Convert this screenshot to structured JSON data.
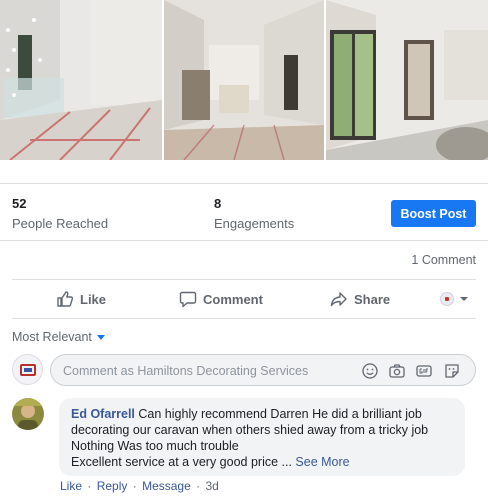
{
  "photos": [
    {
      "name": "room-photo-1"
    },
    {
      "name": "room-photo-2"
    },
    {
      "name": "room-photo-3"
    }
  ],
  "stats": {
    "reached_count": "52",
    "reached_label": "People Reached",
    "engagements_count": "8",
    "engagements_label": "Engagements",
    "boost_label": "Boost Post"
  },
  "comment_count": "1 Comment",
  "actions": {
    "like": "Like",
    "comment": "Comment",
    "share": "Share"
  },
  "sort_label": "Most Relevant",
  "composer": {
    "placeholder": "Comment as Hamiltons Decorating Services",
    "icons": [
      "emoji-icon",
      "camera-icon",
      "gif-icon",
      "sticker-icon"
    ]
  },
  "comment": {
    "author": "Ed Ofarrell",
    "text_1": "Can highly recommend Darren He did a brilliant job",
    "text_2": "decorating our caravan when others shied away from a tricky job",
    "text_3": "Nothing Was too much trouble",
    "text_4": "Excellent service at a very good price ...",
    "see_more": "See More",
    "like": "Like",
    "reply": "Reply",
    "message": "Message",
    "time": "3d",
    "separator": "·"
  },
  "colors": {
    "accent": "#1877f2",
    "link": "#385898",
    "muted": "#606770",
    "divider": "#dddfe2"
  }
}
